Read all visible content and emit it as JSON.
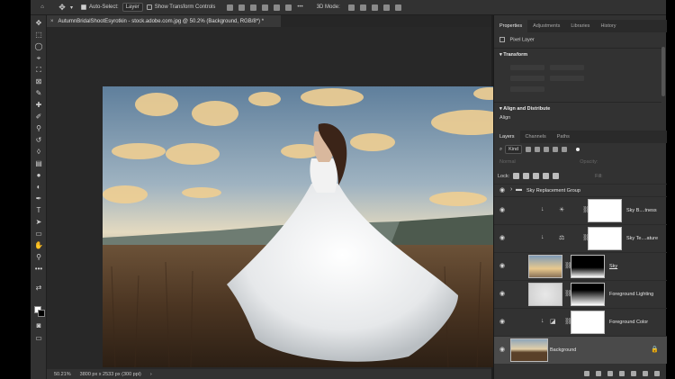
{
  "options_bar": {
    "home_icon": "home-icon",
    "move_icon": "move-tool-icon",
    "auto_select_label": "Auto-Select:",
    "auto_select_value": "Layer",
    "show_transform_label": "Show Transform Controls",
    "mode_3d": "3D Mode:"
  },
  "document": {
    "tab_title": "AutumnBridalShootEsyrotkin - stock.adobe.com.jpg @ 50.2% (Background, RGB/8*) *",
    "tab_close": "×"
  },
  "status": {
    "zoom": "50.21%",
    "dimensions": "3800 px x 2533 px (300 ppi)",
    "arrow": "›"
  },
  "properties_panel": {
    "tabs": [
      "Properties",
      "Adjustments",
      "Libraries",
      "History"
    ],
    "kind_label": "Pixel Layer",
    "transform_heading": "Transform",
    "align_heading": "Align and Distribute",
    "align_label": "Align"
  },
  "layers_panel": {
    "tabs": [
      "Layers",
      "Channels",
      "Paths"
    ],
    "filter_kind": "Kind",
    "blend_mode": "Normal",
    "opacity_label": "Opacity:",
    "lock_label": "Lock:",
    "fill_label": "Fill:",
    "layers": [
      {
        "name": "Sky Replacement Group"
      },
      {
        "name": "Sky B....tness"
      },
      {
        "name": "Sky Te....ature"
      },
      {
        "name": "Sky"
      },
      {
        "name": "Foreground Lighting"
      },
      {
        "name": "Foreground Color"
      },
      {
        "name": "Background"
      }
    ]
  },
  "colors": {
    "ui_dark": "#323232",
    "panel_tab_bar": "#2a2a2a",
    "canvas_bg": "#282828",
    "selected_layer": "#4a4a4a"
  }
}
